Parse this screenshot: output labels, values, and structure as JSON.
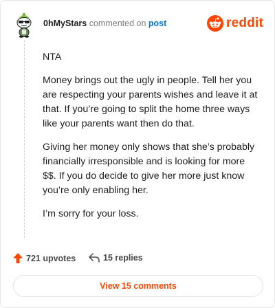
{
  "header": {
    "username": "0hMyStars",
    "commented_on": "commented on",
    "post_link": "post",
    "brand": "reddit",
    "brand_color": "#ff4500"
  },
  "avatar": {
    "icon": "snoo-avatar-icon"
  },
  "comment": {
    "paragraphs": [
      "NTA",
      "Money brings out the ugly in people. Tell her you are respecting your parents wishes and leave it at that. If you’re going to split the home three ways like your parents want then do that.",
      "Giving her money only shows that she’s probably financially irresponsible and is looking for more $$. If you do decide to give her more just know you’re only enabling her.",
      "I’m sorry for your loss."
    ]
  },
  "footer": {
    "upvotes": "721 upvotes",
    "replies": "15 replies",
    "upvote_icon": "upvote-arrow-icon",
    "reply_icon": "reply-arrow-icon"
  },
  "view_comments": "View 15 comments"
}
